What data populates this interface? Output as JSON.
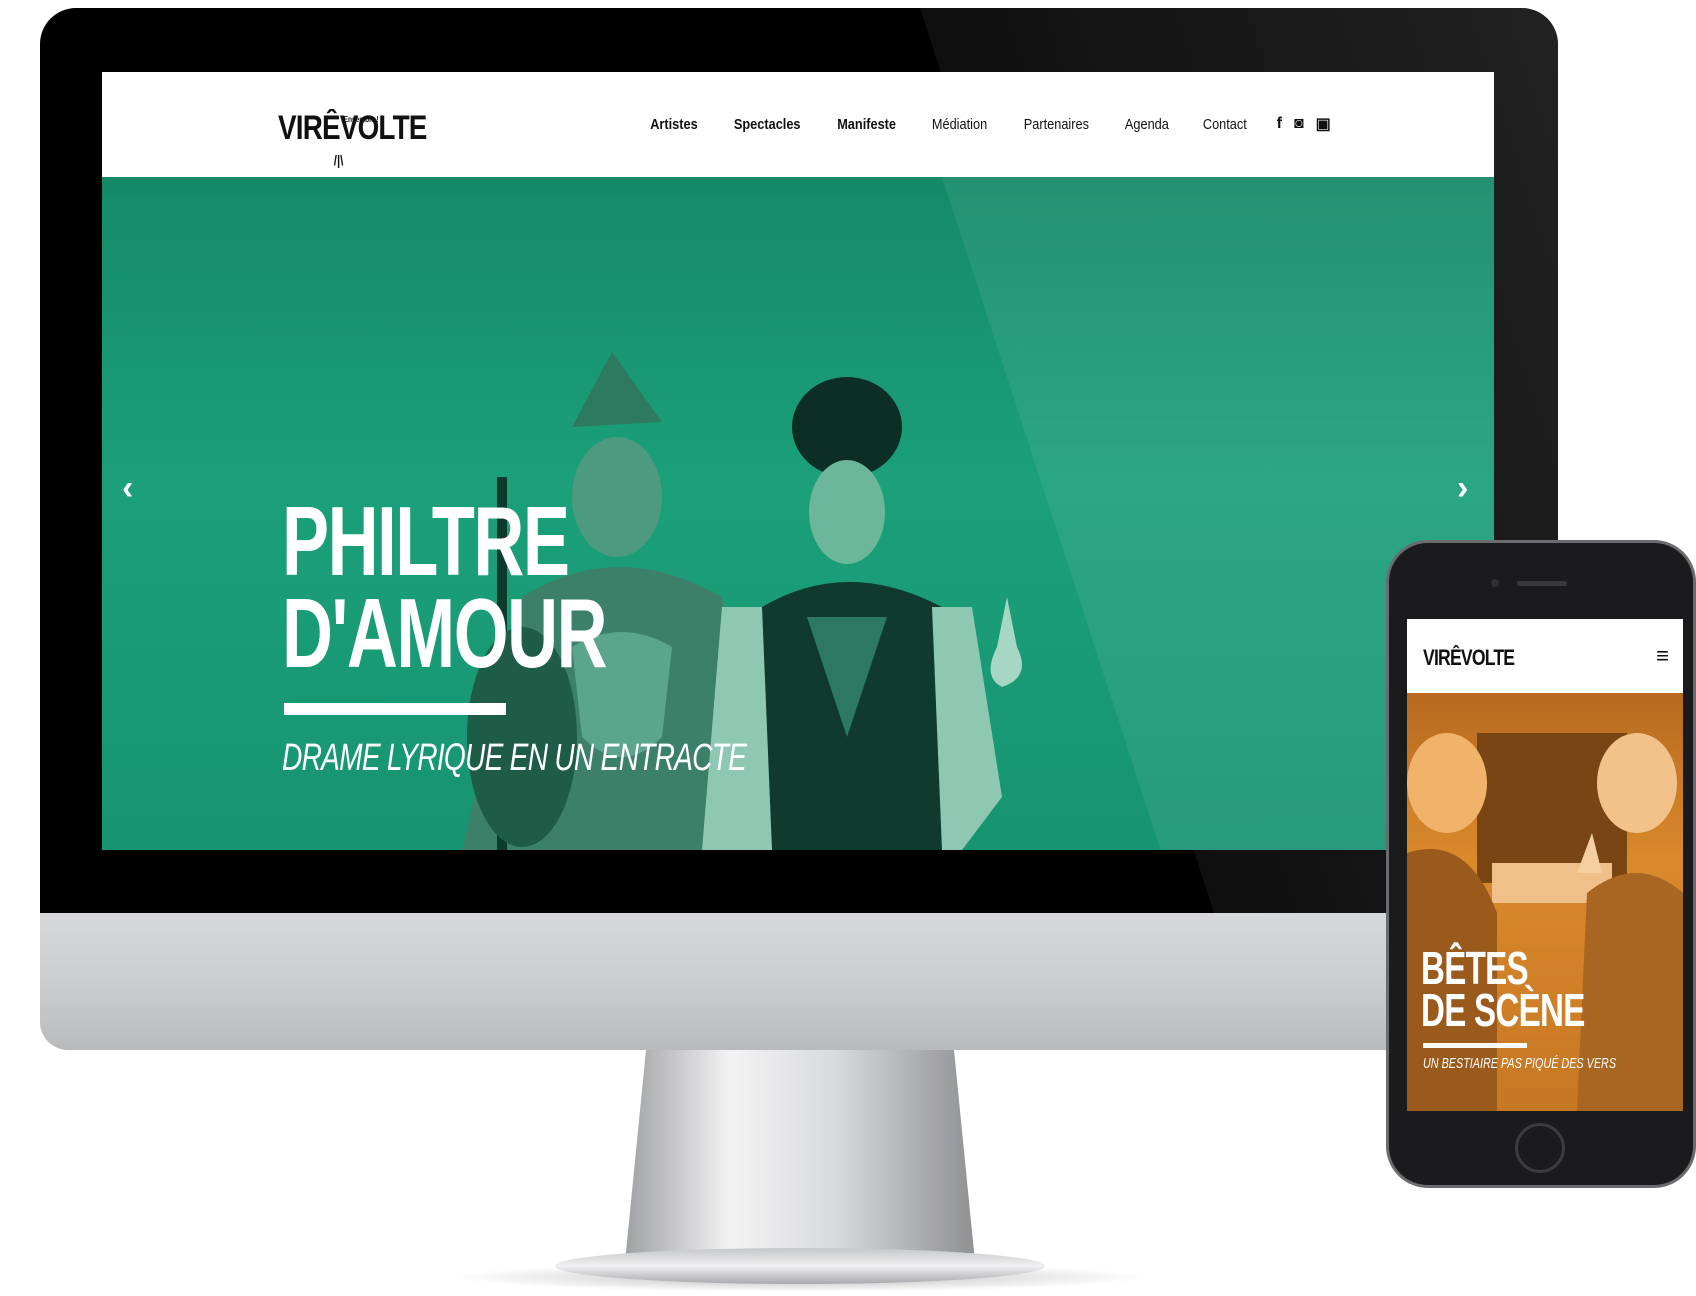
{
  "desktop": {
    "logo": {
      "text_before": "VI",
      "text_re": "RÊ",
      "text_after": "VOLTE",
      "tagline": "Ensemble !"
    },
    "nav": {
      "items": [
        "Artistes",
        "Spectacles",
        "Manifeste",
        "Médiation",
        "Partenaires",
        "Agenda",
        "Contact"
      ]
    },
    "social": [
      {
        "icon": "facebook-icon",
        "glyph": "f"
      },
      {
        "icon": "instagram-icon",
        "glyph": "◙"
      },
      {
        "icon": "youtube-icon",
        "glyph": "▣"
      }
    ],
    "hero": {
      "title_line1": "PHILTRE",
      "title_line2": "D'AMOUR",
      "subtitle": "DRAME LYRIQUE EN UN ENTRACTE",
      "prev_arrow": "‹",
      "next_arrow": "›",
      "tint": "#1a9a74"
    }
  },
  "mobile": {
    "logo": "VIRÊVOLTE",
    "menu_glyph": "≡",
    "hero": {
      "title_line1": "BÊTES",
      "title_line2": "DE SCÈNE",
      "subtitle": "UN BESTIAIRE PAS PIQUÉ DES VERS",
      "tint": "#d4852a"
    }
  }
}
